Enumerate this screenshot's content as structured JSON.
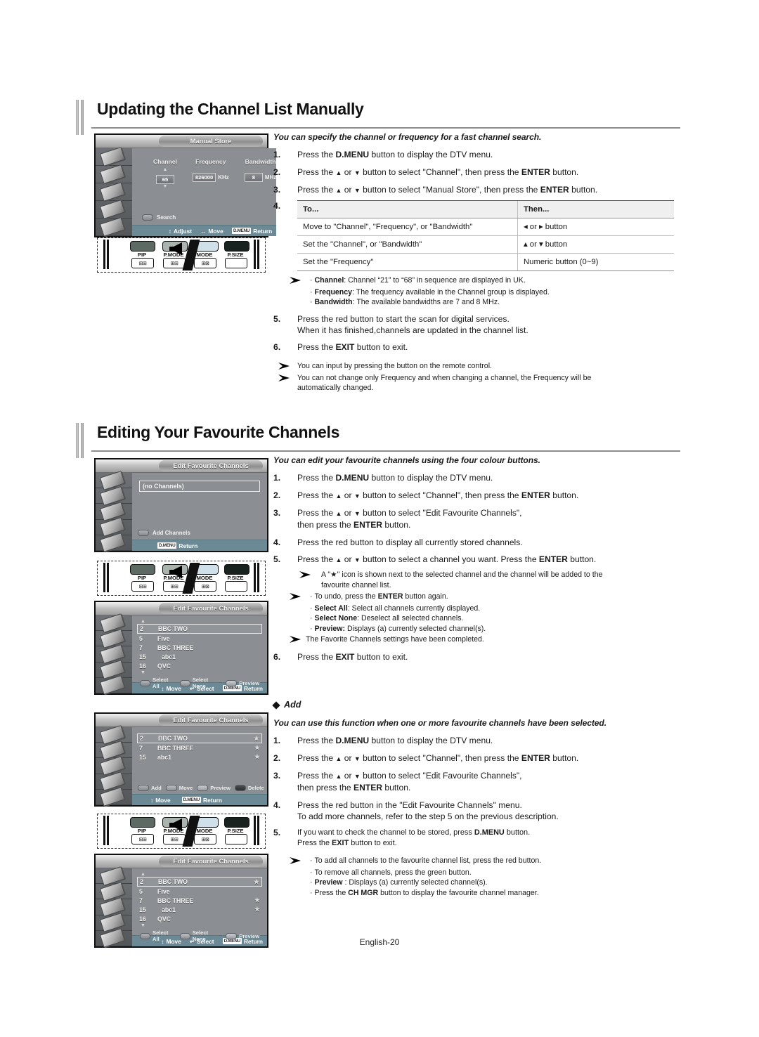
{
  "page": {
    "footer": "English-20"
  },
  "sections": [
    {
      "title": "Updating the Channel List Manually",
      "lead": "You can specify the channel or frequency for a fast channel search.",
      "steps": [
        {
          "num": "1.",
          "text": "Press the D.MENU button to display the DTV menu."
        },
        {
          "num": "2.",
          "text": "Press the ▲ or ▼ button to select \"Channel\", then press the ENTER button."
        },
        {
          "num": "3.",
          "text": "Press the ▲ or ▼ button to select \"Manual Store\", then press the ENTER button."
        },
        {
          "num": "4.",
          "text": ""
        }
      ],
      "table": {
        "headers": [
          "To...",
          "Then..."
        ],
        "rows": [
          [
            "Move to \"Channel\", \"Frequency\", or \"Bandwidth\"",
            "◂  or ▸  button"
          ],
          [
            "Set the \"Channel\", or \"Bandwidth\"",
            "▴  or ▾  button"
          ],
          [
            "Set the \"Frequency\"",
            "Numeric button (0~9)"
          ]
        ]
      },
      "bullets": [
        {
          "label": "Channel",
          "text": ": Channel “21” to “68” in sequence are displayed in UK."
        },
        {
          "label": "Frequency",
          "text": ": The frequency available in the Channel group is displayed."
        },
        {
          "label": "Bandwidth",
          "text": ": The available bandwidths are 7 and 8 MHz."
        }
      ],
      "steps2": [
        {
          "num": "5.",
          "line1": "Press the red button to start the scan for digital services.",
          "line2": "When it has finished,channels are updated in the channel list."
        },
        {
          "num": "6.",
          "line1": "Press the EXIT button to exit.",
          "line2": ""
        }
      ],
      "notes": [
        "You can input by pressing the button on the remote control.",
        "You can not change only Frequency and when changing a channel, the Frequency will be",
        "automatically changed."
      ]
    },
    {
      "title": "Editing Your Favourite Channels",
      "lead": "You can edit your favourite channels using the four colour buttons.",
      "steps": [
        {
          "num": "1.",
          "line1": "Press the D.MENU button to display the DTV menu.",
          "line2": ""
        },
        {
          "num": "2.",
          "line1": "Press the ▲ or ▼ button to select \"Channel\", then press the ENTER button.",
          "line2": ""
        },
        {
          "num": "3.",
          "line1": "Press the ▲ or ▼ button to select \"Edit Favourite Channels\",",
          "line2": "then press the ENTER button."
        },
        {
          "num": "4.",
          "line1": "Press the red button to display all currently stored channels.",
          "line2": ""
        },
        {
          "num": "5.",
          "line1": "Press the ▲ or ▼ button to select a channel you want. Press the ENTER button.",
          "line2": ""
        }
      ],
      "note_star": [
        "A \"★\" icon is shown next to the selected channel and the channel will be added to the",
        "favourite channel list."
      ],
      "bullets": [
        {
          "label": "",
          "text": "To undo, press the ENTER button again.",
          "bold_inline": "ENTER"
        },
        {
          "label": "Select All",
          "text": ": Select all channels currently displayed."
        },
        {
          "label": "Select None",
          "text": ": Deselect all selected channels."
        },
        {
          "label": "Preview:",
          "text": " Displays (a) currently selected channel(s)."
        }
      ],
      "note_done": "The Favorite Channels settings have been completed.",
      "step6": {
        "num": "6.",
        "text": "Press the EXIT button to exit."
      }
    },
    {
      "title": "Add",
      "lead": "You can use this function when one or more favourite channels have been selected.",
      "steps": [
        {
          "num": "1.",
          "line1": "Press the D.MENU button to display the DTV menu.",
          "line2": ""
        },
        {
          "num": "2.",
          "line1": "Press the ▲ or ▼ button to select \"Channel\", then press the ENTER button.",
          "line2": ""
        },
        {
          "num": "3.",
          "line1": "Press the ▲ or ▼ button to select \"Edit Favourite Channels\",",
          "line2": "then press the ENTER button."
        },
        {
          "num": "4.",
          "line1": "Press the red button in the \"Edit Favourite Channels\" menu.",
          "line2": "To add more channels, refer to the step 5 on the previous description."
        },
        {
          "num": "5.",
          "line1": "If you want to check the channel to be stored, press D.MENU button.",
          "line2": "Press the EXIT button to exit."
        }
      ],
      "bullets": [
        "To add all channels to the favourite channel list, press the red button.",
        "To remove all channels, press the green button.",
        "Preview : Displays (a) currently selected channel(s).",
        "Press the CH MGR button to display the favourite channel manager."
      ]
    }
  ],
  "osd": {
    "manual_store": {
      "title": "Manual Store",
      "fields": [
        {
          "label": "Channel",
          "value": "65",
          "unit": ""
        },
        {
          "label": "Frequency",
          "value": "826000",
          "unit": "KHz"
        },
        {
          "label": "Bandwidth",
          "value": "8",
          "unit": "MHz"
        }
      ],
      "search": "Search",
      "bar": [
        {
          "key": "↕",
          "label": "Adjust"
        },
        {
          "key": "↔",
          "label": "Move"
        },
        {
          "key": "D.MENU",
          "label": "Return"
        }
      ]
    },
    "fav_empty": {
      "title": "Edit Favourite Channels",
      "empty_label": "(no Channels)",
      "add_channels": "Add Channels",
      "bar": [
        {
          "key": "D.MENU",
          "label": "Return"
        }
      ]
    },
    "fav_list": {
      "title": "Edit Favourite Channels",
      "rows": [
        {
          "no": "2",
          "name": "BBC TWO",
          "star": "",
          "selected": true
        },
        {
          "no": "5",
          "name": "Five",
          "star": "",
          "selected": false
        },
        {
          "no": "7",
          "name": "BBC THREE",
          "star": "",
          "selected": false
        },
        {
          "no": "15",
          "name": "abc1",
          "star": "",
          "selected": false
        },
        {
          "no": "16",
          "name": "QVC",
          "star": "",
          "selected": false
        }
      ],
      "legend": [
        "Select All",
        "Select None",
        "Preview"
      ],
      "bar": [
        {
          "key": "↕",
          "label": "Move"
        },
        {
          "key": "↵",
          "label": "Select"
        },
        {
          "key": "D.MENU",
          "label": "Return"
        }
      ]
    },
    "fav_added": {
      "title": "Edit Favourite Channels",
      "rows": [
        {
          "no": "2",
          "name": "BBC TWO",
          "star": "★",
          "selected": true
        },
        {
          "no": "7",
          "name": "BBC THREE",
          "star": "★",
          "selected": false
        },
        {
          "no": "15",
          "name": "abc1",
          "star": "★",
          "selected": false
        }
      ],
      "legend": [
        "Add",
        "Move",
        "Preview",
        "Delete"
      ],
      "bar": [
        {
          "key": "↕",
          "label": "Move"
        },
        {
          "key": "D.MENU",
          "label": "Return"
        }
      ]
    },
    "fav_stars": {
      "title": "Edit Favourite Channels",
      "rows": [
        {
          "no": "2",
          "name": "BBC TWO",
          "star": "★",
          "selected": true
        },
        {
          "no": "5",
          "name": "Five",
          "star": "",
          "selected": false
        },
        {
          "no": "7",
          "name": "BBC THREE",
          "star": "★",
          "selected": false
        },
        {
          "no": "15",
          "name": "abc1",
          "star": "★",
          "selected": false
        },
        {
          "no": "16",
          "name": "QVC",
          "star": "",
          "selected": false
        }
      ],
      "legend": [
        "Select All",
        "Select None",
        "Preview"
      ],
      "bar": [
        {
          "key": "↕",
          "label": "Move"
        },
        {
          "key": "↵",
          "label": "Select"
        },
        {
          "key": "D.MENU",
          "label": "Return"
        }
      ]
    }
  },
  "remote": {
    "labels": [
      "PIP",
      "P.MODE",
      "MODE",
      "P.SIZE"
    ],
    "key_glyphs": [
      "⧉",
      "⧉",
      "⧉",
      ""
    ]
  }
}
